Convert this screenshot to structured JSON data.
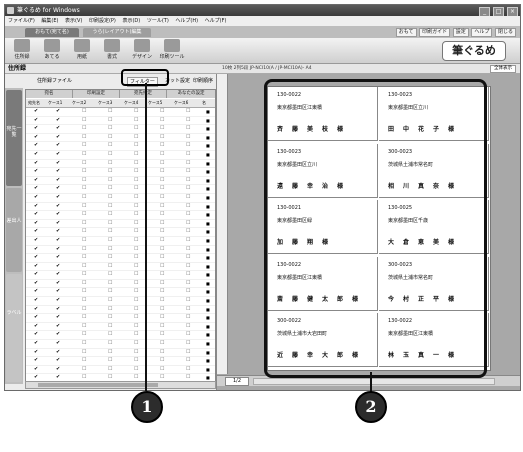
{
  "window": {
    "title": "筆ぐるめ for Windows"
  },
  "titlebar_buttons": [
    "_",
    "□",
    "×"
  ],
  "menu": [
    "ファイル(F)",
    "編集(E)",
    "表示(V)",
    "印刷設定(P)",
    "表示(D)",
    "ツール(T)",
    "ヘルプ(H)",
    "ヘルプ(F)"
  ],
  "tabs": {
    "tab1": "おもて(宛て名)",
    "tab2": "うら(レイアウト)編集"
  },
  "top_right_buttons": [
    "おもて",
    "印刷ガイド",
    "設定",
    "ヘルプ",
    "閉じる"
  ],
  "toolbar": [
    {
      "label": "住所録",
      "icon": "address-book-icon"
    },
    {
      "label": "あてる",
      "icon": "pen-icon"
    },
    {
      "label": "用紙",
      "icon": "paper-icon"
    },
    {
      "label": "書式",
      "icon": "format-icon"
    },
    {
      "label": "デザイン",
      "icon": "design-icon"
    },
    {
      "label": "印刷ツール",
      "icon": "printer-icon"
    }
  ],
  "brand": "筆ぐるめ",
  "subbar": {
    "section": "住所録",
    "info": "10枚 2列5段  JP-NCI10(A / JP-MCI10A)- A4",
    "zoom": "全体表示"
  },
  "left_panel": {
    "address_label": "住所録ファイル",
    "buttons": [
      "フィルター",
      "カット設定",
      "印刷順序"
    ],
    "grid_tabs": [
      "宛名",
      "印刷設定",
      "宛先指定",
      "あなたの設定"
    ],
    "columns": [
      "宛先名",
      "ケース1",
      "ケース2",
      "ケース3",
      "ケース4",
      "ケース5",
      "ケース6",
      "名"
    ],
    "rows": 32,
    "side_tabs": [
      "宛先一覧",
      "差出人",
      "ラベル"
    ]
  },
  "page": {
    "cards": [
      {
        "zip": "130-0022",
        "addr": "東京都墨田区江東橋",
        "name": "斉藤美枝様"
      },
      {
        "zip": "130-0023",
        "addr": "東京都墨田区立川",
        "name": "田中花子様"
      },
      {
        "zip": "130-0023",
        "addr": "東京都墨田区立川",
        "name": "遠藤幸治様"
      },
      {
        "zip": "300-0023",
        "addr": "茨城県土浦市常名町",
        "name": "相川真奈様"
      },
      {
        "zip": "130-0021",
        "addr": "東京都墨田区緑",
        "name": "加藤翔様"
      },
      {
        "zip": "130-0025",
        "addr": "東京都墨田区千歳",
        "name": "大倉恵美様"
      },
      {
        "zip": "130-0022",
        "addr": "東京都墨田区江東橋",
        "name": "斎藤健太郎様"
      },
      {
        "zip": "300-0023",
        "addr": "茨城県土浦市常名町",
        "name": "今村正平様"
      },
      {
        "zip": "300-0022",
        "addr": "茨城県土浦市大岩田町",
        "name": "近藤幸大郎様"
      },
      {
        "zip": "130-0022",
        "addr": "東京都墨田区江東橋",
        "name": "林玉真一様"
      }
    ]
  },
  "bottom": {
    "page": "1/2"
  },
  "callouts": [
    "1",
    "2"
  ]
}
